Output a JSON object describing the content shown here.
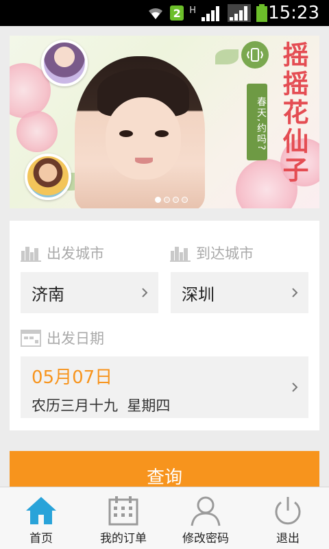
{
  "status_bar": {
    "time": "15:23",
    "sim_badge": "2",
    "network_type": "H"
  },
  "banner": {
    "title": "摇摇花仙子",
    "badge_text": "春天,约吗?",
    "dots_total": 4,
    "dots_active": 0
  },
  "form": {
    "departure_label": "出发城市",
    "departure_value": "济南",
    "arrival_label": "到达城市",
    "arrival_value": "深圳",
    "date_label": "出发日期",
    "date_value": "05月07日",
    "date_lunar": "农历三月十九  星期四"
  },
  "search_button_label": "查询",
  "tabbar": {
    "items": [
      {
        "label": "首页",
        "icon": "home-icon",
        "active": true
      },
      {
        "label": "我的订单",
        "icon": "calendar-icon",
        "active": false
      },
      {
        "label": "修改密码",
        "icon": "user-icon",
        "active": false
      },
      {
        "label": "退出",
        "icon": "power-icon",
        "active": false
      }
    ]
  },
  "colors": {
    "accent": "#f7941d",
    "active_tab": "#29a3d9",
    "inactive_tab": "#9a9a9a"
  }
}
